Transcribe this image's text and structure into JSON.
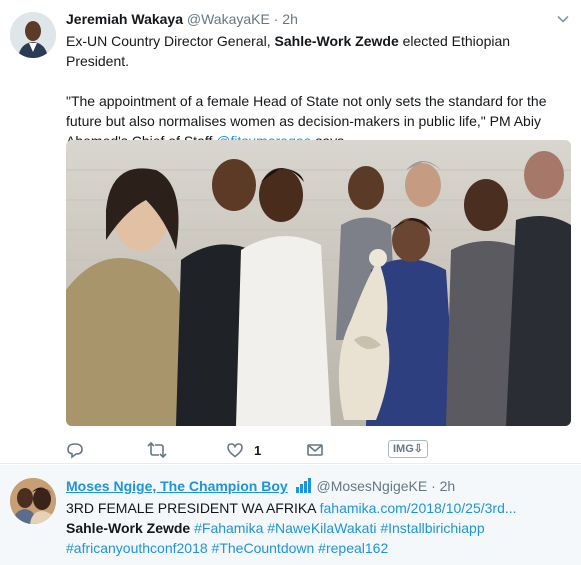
{
  "tweet1": {
    "author_name": "Jeremiah Wakaya",
    "handle": "@WakayaKE",
    "separator": "·",
    "time": "2h",
    "line1_prefix": "Ex-UN Country Director General, ",
    "line1_bold": "Sahle-Work Zewde",
    "line1_suffix": " elected Ethiopian President.",
    "quote_text": "\"The appointment of a female Head of State not only sets the standard for the future but also normalises women as decision-makers in public life,\" PM Abiy Ahemed's Chief of Staff ",
    "mention": "@fitsumaregaa",
    "quote_suffix": " says.",
    "like_count": "1",
    "img_badge": "IMG⇩"
  },
  "tweet2": {
    "author_name": "Moses Ngige, The Champion Boy",
    "handle": "@MosesNgigeKE",
    "separator": "·",
    "time": "2h",
    "text_prefix": "3RD FEMALE PRESIDENT WA AFRIKA ",
    "link": "fahamika.com/2018/10/25/3rd...",
    "bold": "Sahle-Work Zewde",
    "hashtags": "#Fahamika #NaweKilaWakati #Installbirichiapp #africanyouthconf2018 #TheCountdown #repeal162"
  },
  "colors": {
    "link_blue": "#1b95e0",
    "secondary_text": "#657786",
    "primary_text": "#14171a",
    "reply_bg": "#f5f8fa"
  },
  "icons": [
    "chevron-down-icon",
    "reply-icon",
    "retweet-icon",
    "like-icon",
    "direct-message-icon",
    "verified-badge-icon"
  ]
}
